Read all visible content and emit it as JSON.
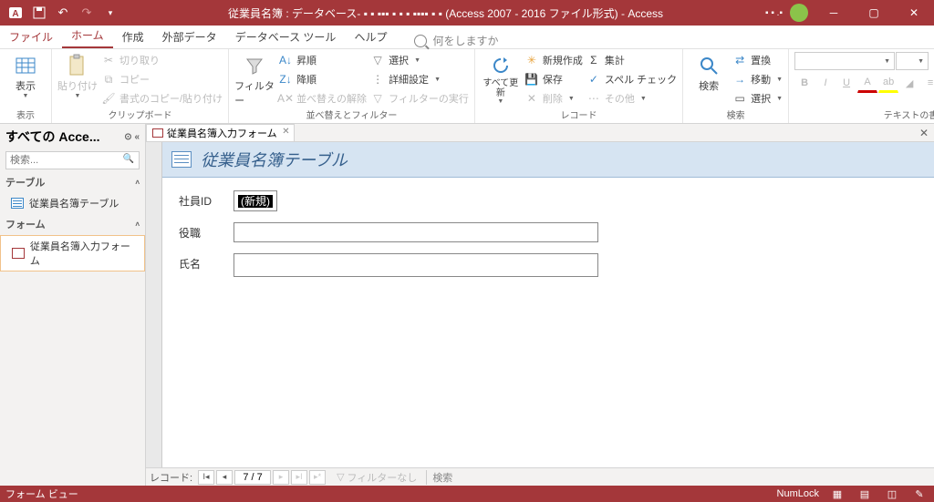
{
  "titlebar": {
    "title": "従業員名簿 : データベース- ▪ ▪ ▪▪▪ ▪ ▪ ▪ ▪▪▪▪ ▪ ▪ (Access 2007 - 2016 ファイル形式)  -  Access"
  },
  "menu": {
    "file": "ファイル",
    "home": "ホーム",
    "create": "作成",
    "external": "外部データ",
    "dbtools": "データベース ツール",
    "help": "ヘルプ",
    "tellme": "何をしますか"
  },
  "ribbon": {
    "view": "表示",
    "view_group": "表示",
    "paste": "貼り付け",
    "cut": "切り取り",
    "copy": "コピー",
    "fmtpaint": "書式のコピー/貼り付け",
    "clipboard_group": "クリップボード",
    "filter": "フィルター",
    "asc": "昇順",
    "desc": "降順",
    "clearorder": "並べ替えの解除",
    "selection": "選択",
    "advanced": "詳細設定",
    "togglefilter": "フィルターの実行",
    "sort_group": "並べ替えとフィルター",
    "refresh": "すべて更新",
    "new": "新規作成",
    "save": "保存",
    "delete": "削除",
    "totals": "集計",
    "spell": "スペル チェック",
    "more": "その他",
    "records_group": "レコード",
    "find": "検索",
    "replace": "置換",
    "goto": "移動",
    "select": "選択",
    "find_group": "検索",
    "textfmt_group": "テキストの書式設定"
  },
  "nav": {
    "title": "すべての Acce...",
    "search_ph": "検索...",
    "tables": "テーブル",
    "table1": "従業員名簿テーブル",
    "forms": "フォーム",
    "form1": "従業員名簿入力フォーム"
  },
  "doc": {
    "tab": "従業員名簿入力フォーム",
    "form_title": "従業員名簿テーブル",
    "f_id": "社員ID",
    "f_id_val": "(新規)",
    "f_role": "役職",
    "f_name": "氏名"
  },
  "recnav": {
    "label": "レコード:",
    "pos": "7 / 7",
    "nofilter": "フィルターなし",
    "search": "検索"
  },
  "status": {
    "left": "フォーム ビュー",
    "numlock": "NumLock"
  }
}
